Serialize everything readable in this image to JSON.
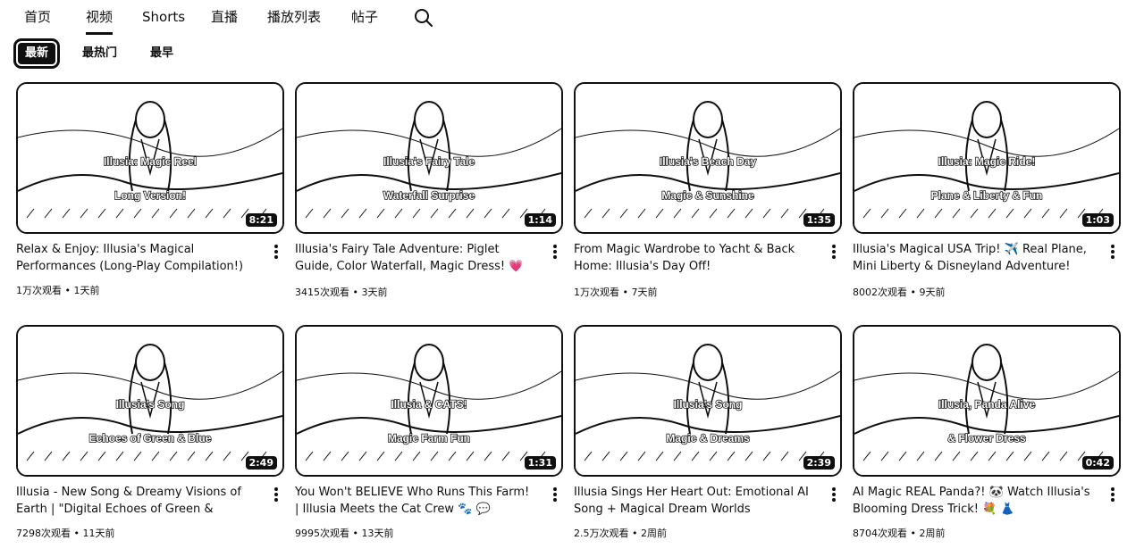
{
  "tabs": [
    {
      "label": "首页",
      "active": false
    },
    {
      "label": "视频",
      "active": true
    },
    {
      "label": "Shorts",
      "active": false
    },
    {
      "label": "直播",
      "active": false
    },
    {
      "label": "播放列表",
      "active": false
    },
    {
      "label": "帖子",
      "active": false
    }
  ],
  "search_icon": "search-icon",
  "chips": [
    {
      "label": "最新",
      "active": true
    },
    {
      "label": "最热门",
      "active": false
    },
    {
      "label": "最早",
      "active": false
    }
  ],
  "videos": [
    {
      "thumb_line1": "Illusia: Magic Reel",
      "thumb_line2": "Long Version!",
      "duration": "8:21",
      "title": "Relax & Enjoy: Illusia's Magical Performances (Long-Play Compilation!) 😊",
      "meta": "1万次观看 • 1天前"
    },
    {
      "thumb_line1": "Illusia's Fairy Tale",
      "thumb_line2": "Waterfall Surprise",
      "duration": "1:14",
      "title": "Illusia's Fairy Tale Adventure: Piglet Guide, Color Waterfall, Magic Dress! 💗",
      "meta": "3415次观看 • 3天前"
    },
    {
      "thumb_line1": "Illusia's Beach Day",
      "thumb_line2": "Magic & Sunshine",
      "duration": "1:35",
      "title": "From Magic Wardrobe to Yacht & Back Home: Illusia's Day Off!",
      "meta": "1万次观看 • 7天前"
    },
    {
      "thumb_line1": "Illusia: Magic Ride!",
      "thumb_line2": "Plane & Liberty & Fun",
      "duration": "1:03",
      "title": "Illusia's Magical USA Trip! ✈️ Real Plane, Mini Liberty & Disneyland Adventure!",
      "meta": "8002次观看 • 9天前"
    },
    {
      "thumb_line1": "Illusia's Song",
      "thumb_line2": "Echoes of Green & Blue",
      "duration": "2:49",
      "title": "Illusia - New Song & Dreamy Visions of Earth | \"Digital Echoes of Green & Blue\"...",
      "meta": "7298次观看 • 11天前"
    },
    {
      "thumb_line1": "Illusia & CATS!",
      "thumb_line2": "Magic Farm Fun",
      "duration": "1:31",
      "title": "You Won't BELIEVE Who Runs This Farm! | Illusia Meets the Cat Crew 🐾 💬",
      "meta": "9995次观看 • 13天前"
    },
    {
      "thumb_line1": "Illusia's Song",
      "thumb_line2": "Magic & Dreams",
      "duration": "2:39",
      "title": "Illusia Sings Her Heart Out: Emotional AI Song + Magical Dream Worlds",
      "meta": "2.5万次观看 • 2周前"
    },
    {
      "thumb_line1": "Illusia, Panda Alive",
      "thumb_line2": "& Flower Dress",
      "duration": "0:42",
      "title": "AI Magic REAL Panda?! 🐼 Watch Illusia's Blooming Dress Trick! 💐 👗",
      "meta": "8704次观看 • 2周前"
    }
  ]
}
